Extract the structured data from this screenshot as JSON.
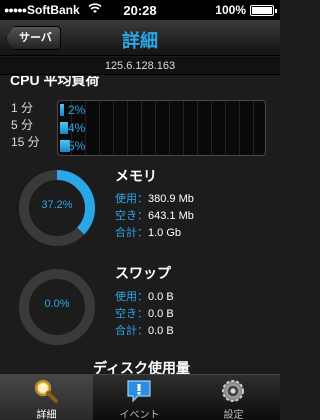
{
  "statusbar": {
    "signal": "●●●●●",
    "carrier": "SoftBank",
    "time": "20:28",
    "battery_pct": "100%",
    "battery_level": 1.0
  },
  "navbar": {
    "back_label": "サーバ",
    "title": "詳細"
  },
  "ip": "125.6.128.163",
  "cpu": {
    "title": "CPU 平均負荷",
    "rows": [
      {
        "label": "1 分",
        "value": "2%",
        "level": 0.02
      },
      {
        "label": "5 分",
        "value": "4%",
        "level": 0.04
      },
      {
        "label": "15 分",
        "value": "5%",
        "level": 0.05
      }
    ]
  },
  "memory": {
    "title": "メモリ",
    "percent_label": "37.2%",
    "percent": 0.372,
    "rows": [
      {
        "label": "使用",
        "value": "380.9 Mb"
      },
      {
        "label": "空き",
        "value": "643.1 Mb"
      },
      {
        "label": "合計",
        "value": "1.0 Gb"
      }
    ]
  },
  "swap": {
    "title": "スワップ",
    "percent_label": "0.0%",
    "percent": 0.0,
    "rows": [
      {
        "label": "使用",
        "value": "0.0 B"
      },
      {
        "label": "空き",
        "value": "0.0 B"
      },
      {
        "label": "合計",
        "value": "0.0 B"
      }
    ]
  },
  "disk": {
    "title": "ディスク使用量"
  },
  "tabs": [
    {
      "label": "詳細",
      "icon": "magnifier-icon",
      "active": true
    },
    {
      "label": "イベント",
      "icon": "alert-bubble-icon",
      "active": false
    },
    {
      "label": "設定",
      "icon": "gear-icon",
      "active": false
    }
  ],
  "colors": {
    "accent": "#2aa7e8",
    "background": "#1c1c1c"
  }
}
